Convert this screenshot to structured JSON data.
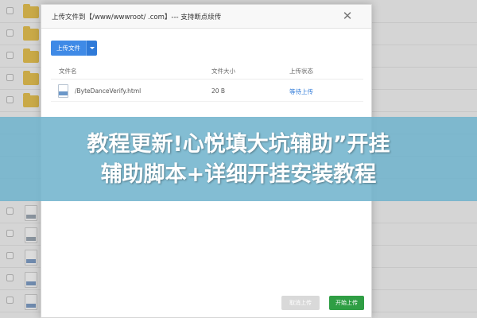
{
  "dialog": {
    "title": "上传文件到【/www/wwwroot/          .com】--- 支持断点续传",
    "close_glyph": "✕"
  },
  "toolbar": {
    "upload_label": "上传文件"
  },
  "table": {
    "headers": [
      "文件名",
      "文件大小",
      "上传状态"
    ],
    "rows": [
      {
        "name": "/ByteDanceVerify.html",
        "size": "20 B",
        "status": "等待上传"
      }
    ]
  },
  "footer": {
    "cancel_label": "取消上传",
    "start_label": "开始上传"
  },
  "banner": {
    "line1": "教程更新!心悦填大坑辅助”开挂",
    "line2": "辅助脚本+详细开挂安装教程"
  },
  "colors": {
    "primary_button": "#3f8ae6",
    "start_button": "#2f9e44",
    "banner_bg": "#72b4cd"
  },
  "icons": {
    "close": "close-icon",
    "file": "html-file-icon",
    "dropdown": "chevron-down-icon"
  }
}
